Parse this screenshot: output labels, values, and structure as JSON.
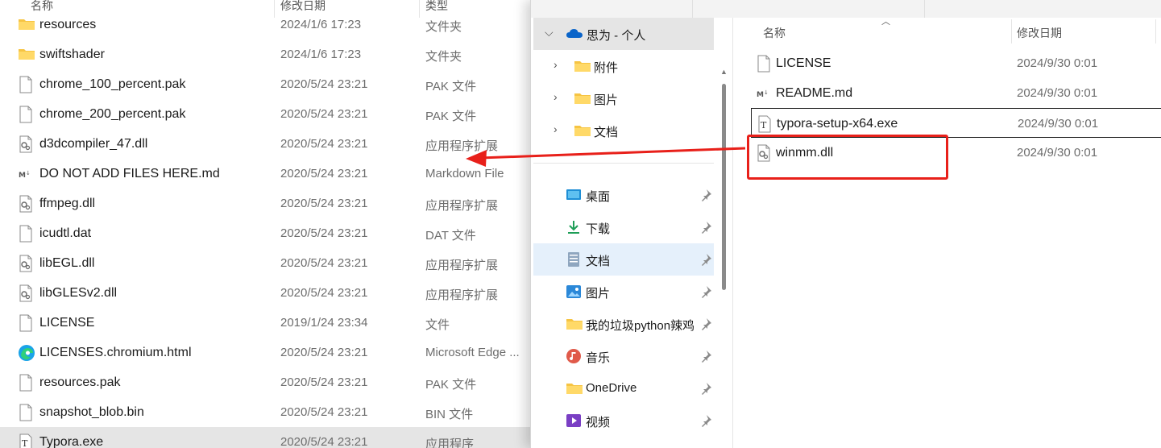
{
  "left_explorer": {
    "columns": {
      "name": "名称",
      "modified": "修改日期",
      "type": "类型"
    },
    "rows": [
      {
        "icon": "folder-icon",
        "name": "resources",
        "date": "2024/1/6 17:23",
        "type": "文件夹"
      },
      {
        "icon": "folder-icon",
        "name": "swiftshader",
        "date": "2024/1/6 17:23",
        "type": "文件夹"
      },
      {
        "icon": "file-icon",
        "name": "chrome_100_percent.pak",
        "date": "2020/5/24 23:21",
        "type": "PAK 文件"
      },
      {
        "icon": "file-icon",
        "name": "chrome_200_percent.pak",
        "date": "2020/5/24 23:21",
        "type": "PAK 文件"
      },
      {
        "icon": "dll-icon",
        "name": "d3dcompiler_47.dll",
        "date": "2020/5/24 23:21",
        "type": "应用程序扩展"
      },
      {
        "icon": "markdown-icon",
        "name": "DO NOT ADD FILES HERE.md",
        "date": "2020/5/24 23:21",
        "type": "Markdown File"
      },
      {
        "icon": "dll-icon",
        "name": "ffmpeg.dll",
        "date": "2020/5/24 23:21",
        "type": "应用程序扩展"
      },
      {
        "icon": "file-icon",
        "name": "icudtl.dat",
        "date": "2020/5/24 23:21",
        "type": "DAT 文件"
      },
      {
        "icon": "dll-icon",
        "name": "libEGL.dll",
        "date": "2020/5/24 23:21",
        "type": "应用程序扩展"
      },
      {
        "icon": "dll-icon",
        "name": "libGLESv2.dll",
        "date": "2020/5/24 23:21",
        "type": "应用程序扩展"
      },
      {
        "icon": "file-icon",
        "name": "LICENSE",
        "date": "2019/1/24 23:34",
        "type": "文件"
      },
      {
        "icon": "edge-icon",
        "name": "LICENSES.chromium.html",
        "date": "2020/5/24 23:21",
        "type": "Microsoft Edge ..."
      },
      {
        "icon": "file-icon",
        "name": "resources.pak",
        "date": "2020/5/24 23:21",
        "type": "PAK 文件"
      },
      {
        "icon": "file-icon",
        "name": "snapshot_blob.bin",
        "date": "2020/5/24 23:21",
        "type": "BIN 文件"
      },
      {
        "icon": "typora-icon",
        "name": "Typora.exe",
        "date": "2020/5/24 23:21",
        "type": "应用程序"
      }
    ]
  },
  "right_explorer": {
    "nav": {
      "account": "思为 - 个人",
      "account_children": [
        "附件",
        "图片",
        "文档"
      ],
      "quick_access": [
        {
          "icon": "desktop-icon",
          "label": "桌面"
        },
        {
          "icon": "download-icon",
          "label": "下载"
        },
        {
          "icon": "documents-icon",
          "label": "文档"
        },
        {
          "icon": "pictures-icon",
          "label": "图片"
        },
        {
          "icon": "folder-icon",
          "label": "我的垃圾python辣鸡"
        },
        {
          "icon": "music-icon",
          "label": "音乐"
        },
        {
          "icon": "folder-icon",
          "label": "OneDrive"
        },
        {
          "icon": "videos-icon",
          "label": "视频"
        }
      ]
    },
    "columns": {
      "name": "名称",
      "modified": "修改日期"
    },
    "rows": [
      {
        "icon": "file-icon",
        "name": "LICENSE",
        "date": "2024/9/30 0:01"
      },
      {
        "icon": "markdown-icon",
        "name": "README.md",
        "date": "2024/9/30 0:01"
      },
      {
        "icon": "typora-icon",
        "name": "typora-setup-x64.exe",
        "date": "2024/9/30 0:01"
      },
      {
        "icon": "dll-icon",
        "name": "winmm.dll",
        "date": "2024/9/30 0:01"
      }
    ]
  },
  "annotation": {
    "box_color": "#e8201a",
    "arrow_color": "#e8201a"
  },
  "colors": {
    "accent": "#0067c0",
    "selected_bg": "#cce8ff",
    "hover_bg": "#e5e5e5"
  }
}
